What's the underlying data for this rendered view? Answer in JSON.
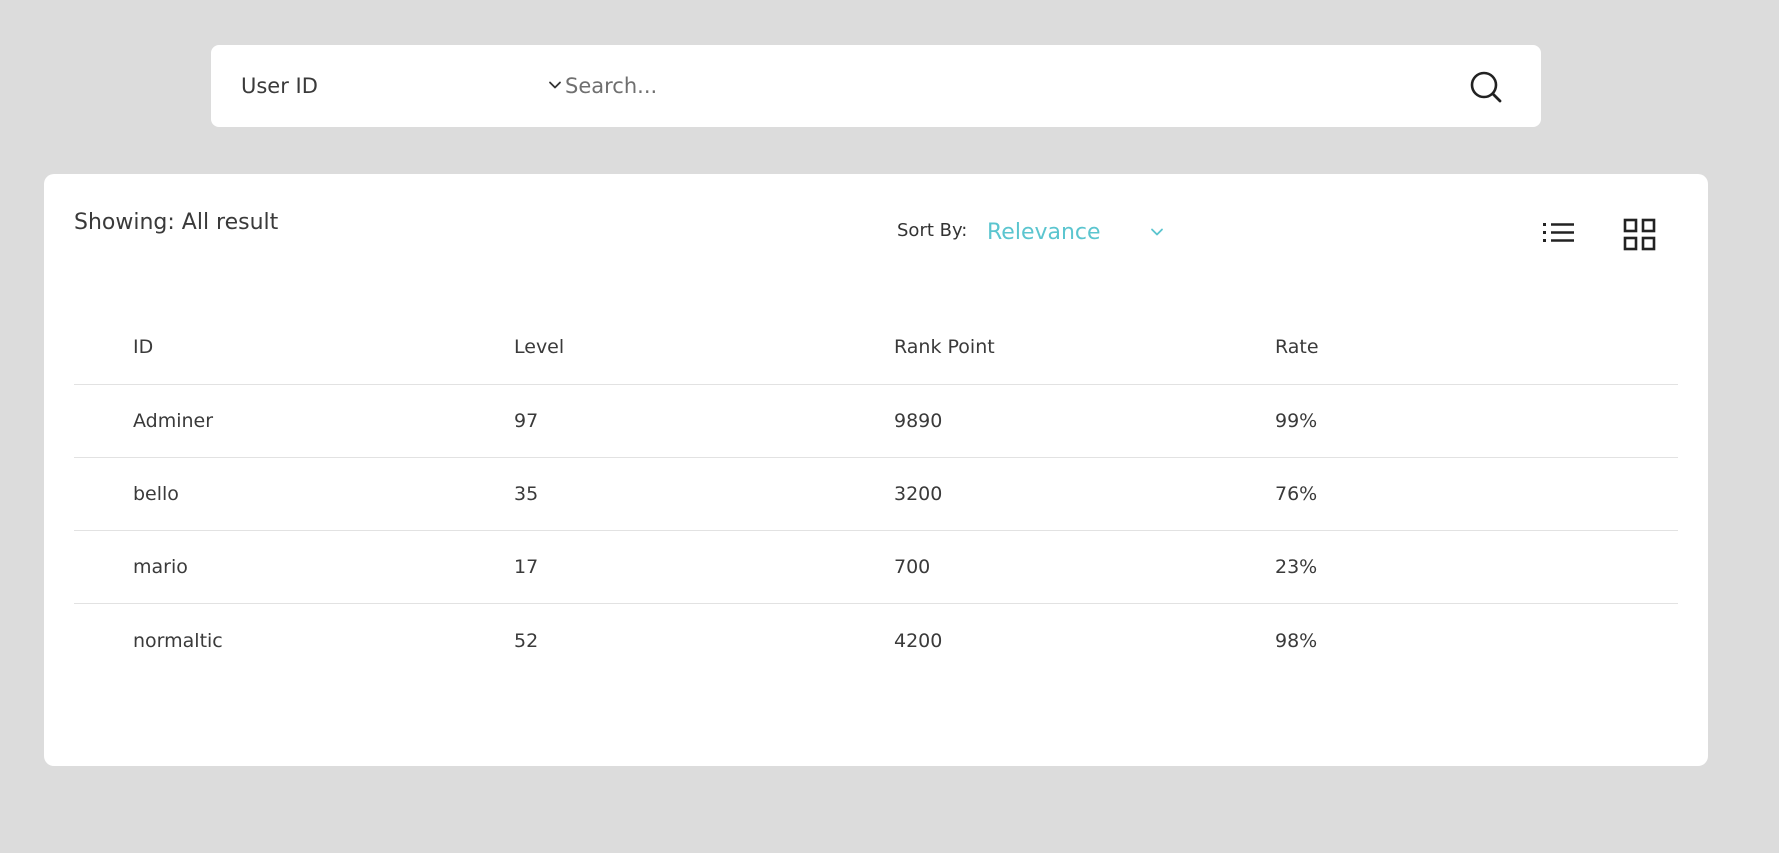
{
  "search": {
    "filter_value": "User ID",
    "filter_icon": "chevron-down-icon",
    "placeholder": "Search...",
    "value": "",
    "search_icon": "search-icon"
  },
  "results": {
    "showing_text": "Showing: All result",
    "sort_label": "Sort By:",
    "sort_value": "Relevance",
    "sort_icon": "chevron-down-icon",
    "accent_color": "#5bc5cf",
    "view_list_icon": "list-view-icon",
    "view_grid_icon": "grid-view-icon"
  },
  "table": {
    "columns": [
      "ID",
      "Level",
      "Rank Point",
      "Rate"
    ],
    "rows": [
      {
        "id": "Adminer",
        "level": "97",
        "rank_point": "9890",
        "rate": "99%"
      },
      {
        "id": "bello",
        "level": "35",
        "rank_point": "3200",
        "rate": "76%"
      },
      {
        "id": "mario",
        "level": "17",
        "rank_point": "700",
        "rate": "23%"
      },
      {
        "id": "normaltic",
        "level": "52",
        "rank_point": "4200",
        "rate": "98%"
      }
    ]
  }
}
